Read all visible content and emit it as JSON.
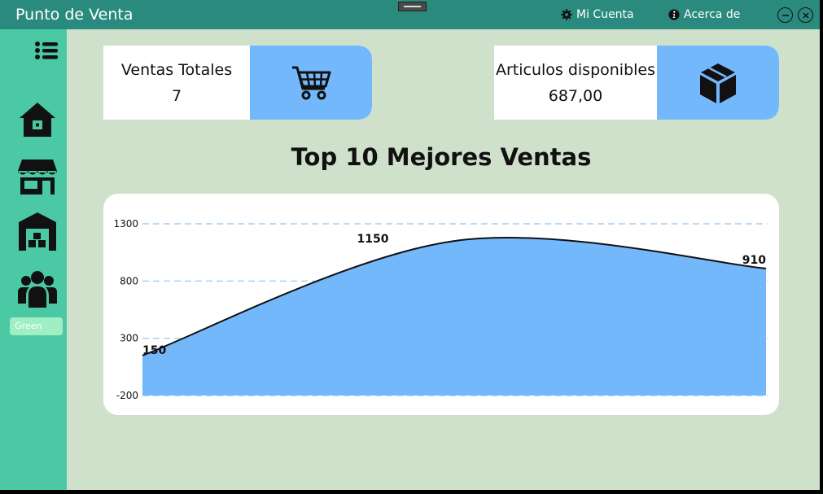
{
  "window": {
    "title": "Punto de Venta"
  },
  "titlebar": {
    "account_label": "Mi Cuenta",
    "about_label": "Acerca de"
  },
  "sidebar": {
    "items": [
      {
        "icon": "menu-icon"
      },
      {
        "icon": "home-icon"
      },
      {
        "icon": "store-icon"
      },
      {
        "icon": "warehouse-icon"
      },
      {
        "icon": "users-icon"
      }
    ],
    "theme_label": "Green"
  },
  "cards": {
    "sales": {
      "label": "Ventas Totales",
      "value": "7",
      "icon": "cart-icon"
    },
    "items": {
      "label": "Articulos disponibles",
      "value": "687,00",
      "icon": "box-icon"
    }
  },
  "main": {
    "chart_title": "Top 10 Mejores Ventas"
  },
  "colors": {
    "titlebar": "#2a8a7d",
    "sidebar": "#4bc9a5",
    "background": "#cfe1cb",
    "accent": "#74b8fc"
  },
  "chart_data": {
    "type": "area",
    "title": "Top 10 Mejores Ventas",
    "x": [
      0,
      1,
      2
    ],
    "values": [
      150,
      1150,
      910
    ],
    "data_labels": [
      "150",
      "1150",
      "910"
    ],
    "yticks": [
      "1300",
      "800",
      "300",
      "-200"
    ],
    "ylim": [
      -200,
      1300
    ],
    "grid": true
  }
}
